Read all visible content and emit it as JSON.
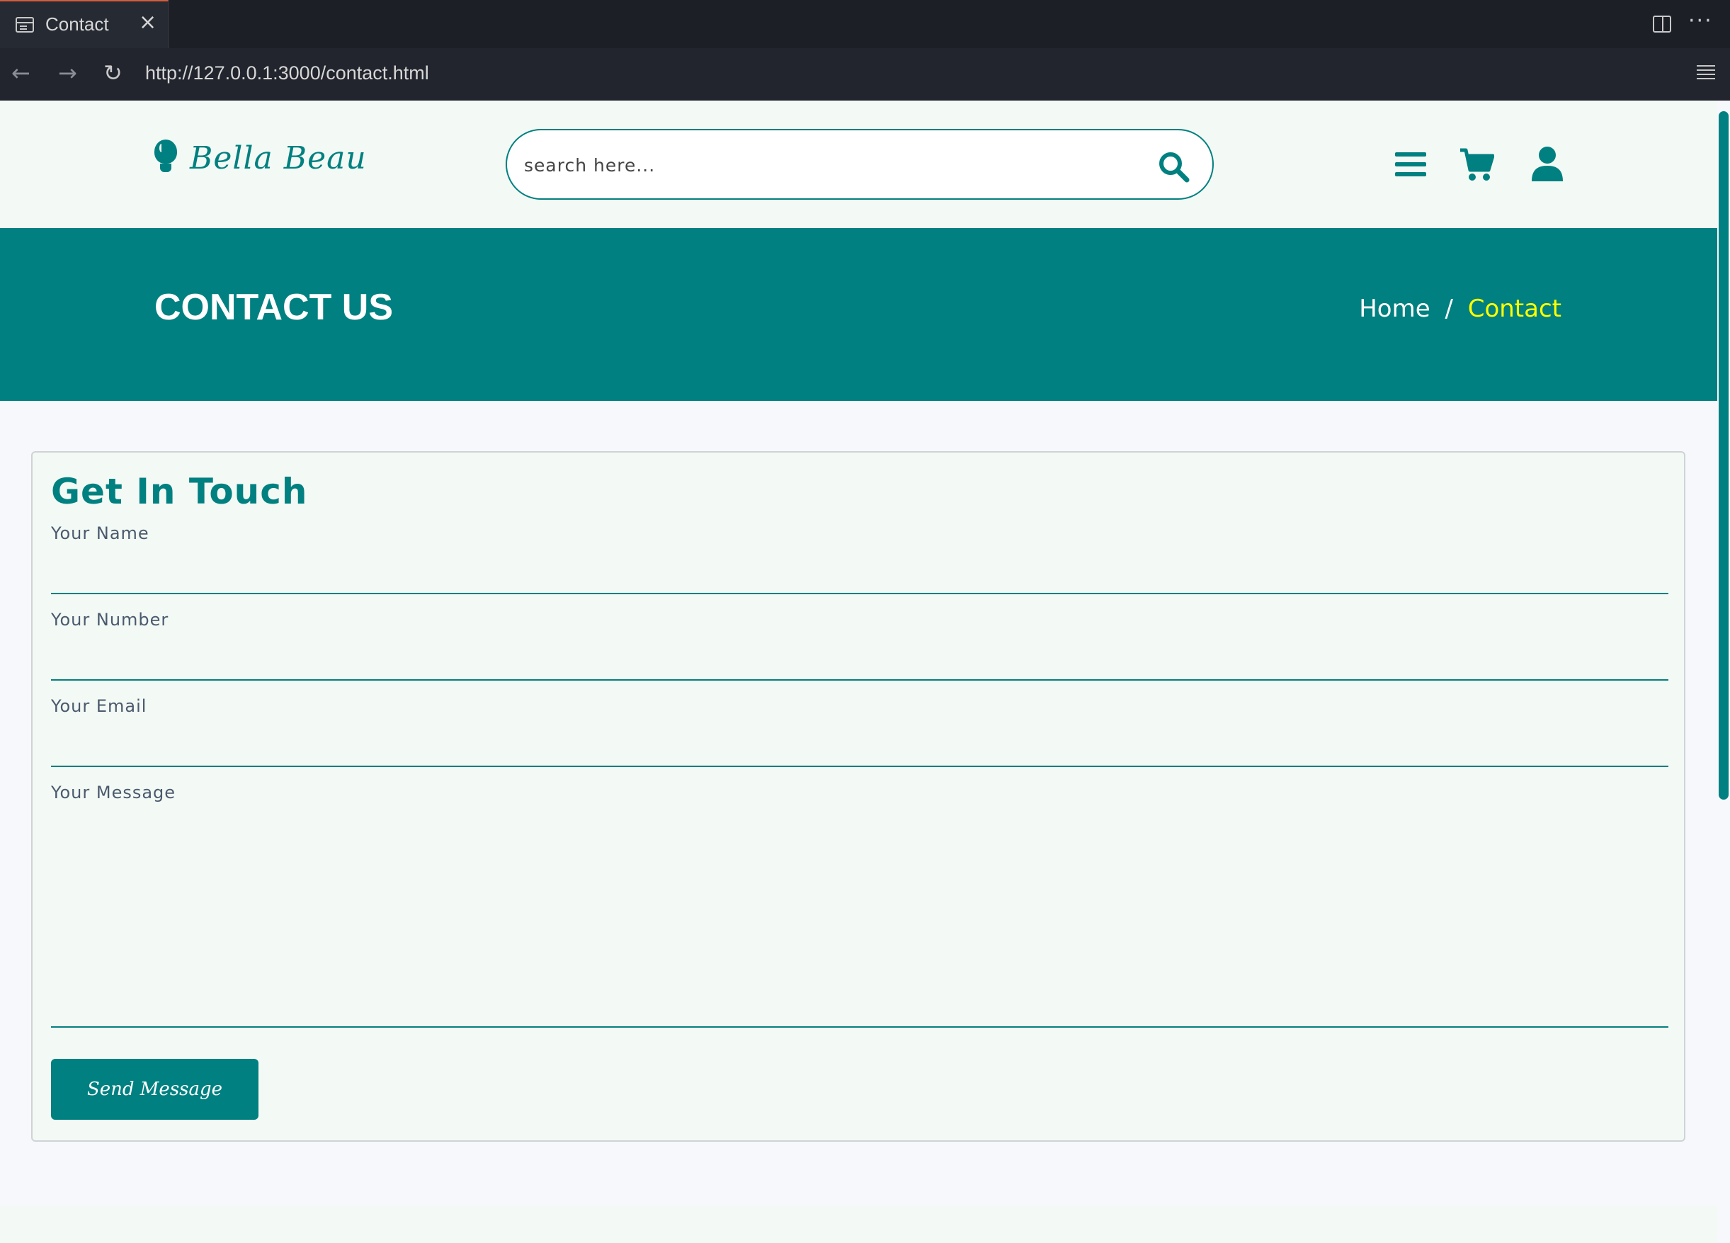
{
  "browser": {
    "tab_title": "Contact",
    "tab_close": "×",
    "url": "http://127.0.0.1:3000/contact.html",
    "more": "···",
    "back": "←",
    "forward": "→",
    "reload": "↻"
  },
  "header": {
    "logo_text": "Bella Beau",
    "search_placeholder": "search here...",
    "icons": [
      "bars-icon",
      "cart-icon",
      "user-icon",
      "search-icon",
      "lightbulb-icon"
    ]
  },
  "banner": {
    "title": "CONTACT US",
    "breadcrumb_home": "Home",
    "breadcrumb_sep": "/",
    "breadcrumb_current": "Contact"
  },
  "form": {
    "title": "Get In Touch",
    "name_label": "Your Name",
    "number_label": "Your Number",
    "email_label": "Your Email",
    "message_label": "Your Message",
    "submit_label": "Send Message"
  },
  "colors": {
    "accent": "#008080",
    "highlight": "#ffff00",
    "header_bg": "#f3f9f4",
    "page_bg": "#f7f8fc"
  }
}
